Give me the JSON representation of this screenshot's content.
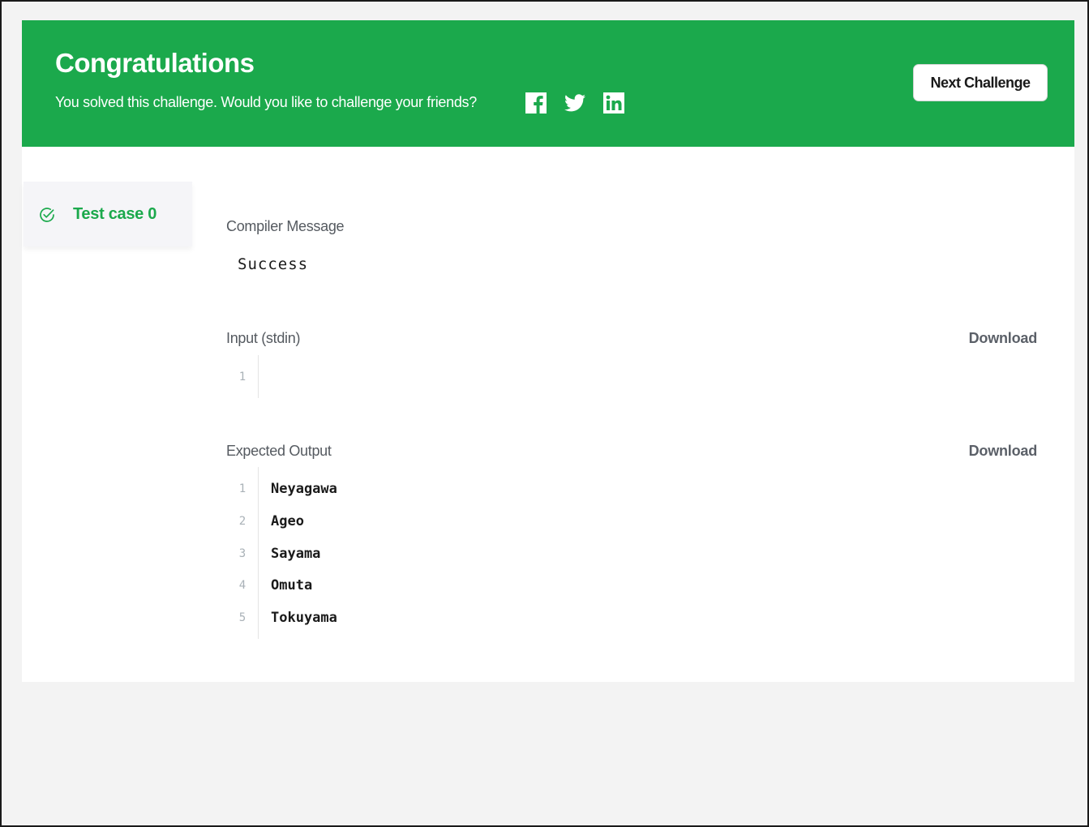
{
  "banner": {
    "title": "Congratulations",
    "subtitle": "You solved this challenge. Would you like to challenge your friends?",
    "social_icons": [
      "facebook-icon",
      "twitter-icon",
      "linkedin-icon"
    ],
    "next_button_label": "Next Challenge",
    "color": "#1ba94c"
  },
  "tabs": [
    {
      "label": "Test case 0",
      "icon": "check-circle-icon",
      "status": "passed"
    }
  ],
  "compiler": {
    "label": "Compiler Message",
    "message": "Success"
  },
  "input": {
    "label": "Input (stdin)",
    "download_label": "Download",
    "line_numbers": [
      "1"
    ],
    "lines": [
      ""
    ]
  },
  "expected_output": {
    "label": "Expected Output",
    "download_label": "Download",
    "line_numbers": [
      "1",
      "2",
      "3",
      "4",
      "5"
    ],
    "lines": [
      "Neyagawa",
      "Ageo",
      "Sayama",
      "Omuta",
      "Tokuyama"
    ]
  },
  "colors": {
    "accent": "#1ba94c",
    "muted_text": "#5b6068",
    "background": "#f3f3f3"
  }
}
